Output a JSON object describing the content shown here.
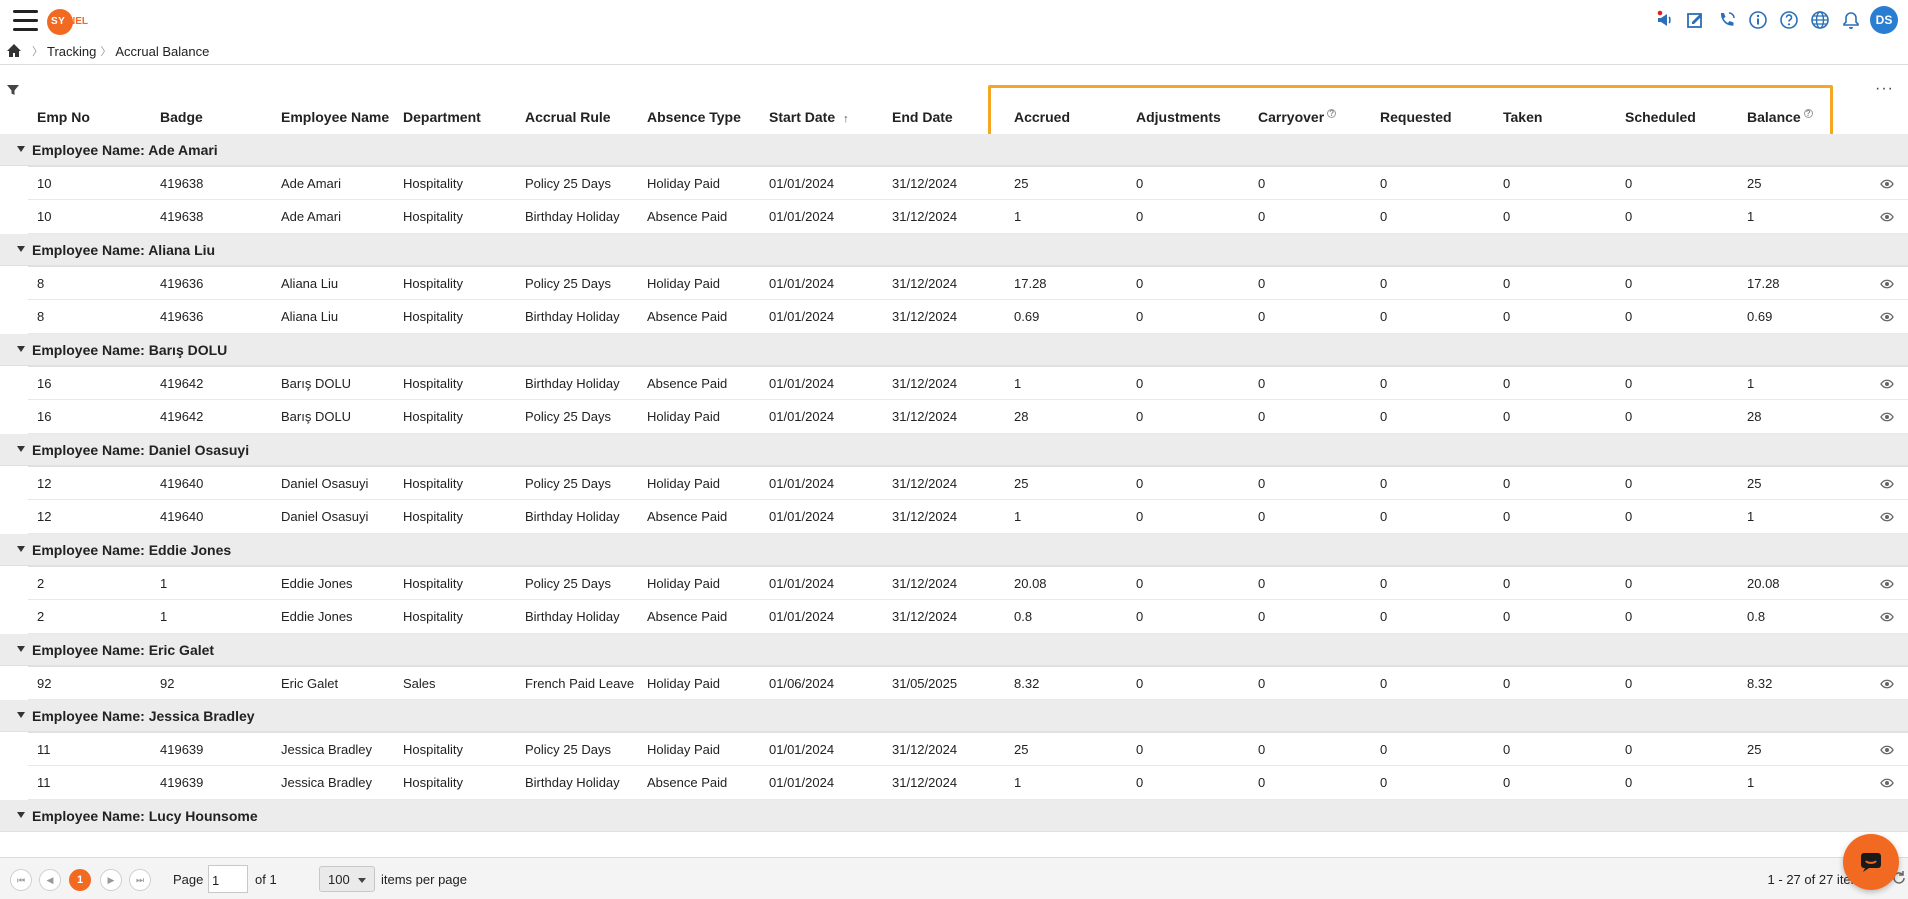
{
  "app": {
    "logo_text_a": "SY",
    "logo_text_b": "NEL",
    "user_initials": "DS"
  },
  "top_icons": [
    "announcement-icon",
    "timesheet-edit-icon",
    "phone-support-icon",
    "info-icon",
    "help-icon",
    "language-globe-icon",
    "notifications-bell-icon"
  ],
  "breadcrumb": {
    "items": [
      "Tracking",
      "Accrual Balance"
    ]
  },
  "grid": {
    "columns": [
      "Emp No",
      "Badge",
      "Employee Name",
      "Department",
      "Accrual Rule",
      "Absence Type",
      "Start Date",
      "End Date",
      "Accrued",
      "Adjustments",
      "Carryover",
      "Requested",
      "Taken",
      "Scheduled",
      "Balance"
    ],
    "help_marker": "?",
    "sort_indicator": "↑",
    "groups": [
      {
        "label": "Employee Name: Ade Amari",
        "rows": [
          [
            "10",
            "419638",
            "Ade Amari",
            "Hospitality",
            "Policy 25 Days",
            "Holiday Paid",
            "01/01/2024",
            "31/12/2024",
            "25",
            "0",
            "0",
            "0",
            "0",
            "0",
            "25"
          ],
          [
            "10",
            "419638",
            "Ade Amari",
            "Hospitality",
            "Birthday Holiday",
            "Absence Paid",
            "01/01/2024",
            "31/12/2024",
            "1",
            "0",
            "0",
            "0",
            "0",
            "0",
            "1"
          ]
        ]
      },
      {
        "label": "Employee Name: Aliana Liu",
        "rows": [
          [
            "8",
            "419636",
            "Aliana Liu",
            "Hospitality",
            "Policy 25 Days",
            "Holiday Paid",
            "01/01/2024",
            "31/12/2024",
            "17.28",
            "0",
            "0",
            "0",
            "0",
            "0",
            "17.28"
          ],
          [
            "8",
            "419636",
            "Aliana Liu",
            "Hospitality",
            "Birthday Holiday",
            "Absence Paid",
            "01/01/2024",
            "31/12/2024",
            "0.69",
            "0",
            "0",
            "0",
            "0",
            "0",
            "0.69"
          ]
        ]
      },
      {
        "label": "Employee Name: Barış DOLU",
        "rows": [
          [
            "16",
            "419642",
            "Barış DOLU",
            "Hospitality",
            "Birthday Holiday",
            "Absence Paid",
            "01/01/2024",
            "31/12/2024",
            "1",
            "0",
            "0",
            "0",
            "0",
            "0",
            "1"
          ],
          [
            "16",
            "419642",
            "Barış DOLU",
            "Hospitality",
            "Policy 25 Days",
            "Holiday Paid",
            "01/01/2024",
            "31/12/2024",
            "28",
            "0",
            "0",
            "0",
            "0",
            "0",
            "28"
          ]
        ]
      },
      {
        "label": "Employee Name: Daniel Osasuyi",
        "rows": [
          [
            "12",
            "419640",
            "Daniel Osasuyi",
            "Hospitality",
            "Policy 25 Days",
            "Holiday Paid",
            "01/01/2024",
            "31/12/2024",
            "25",
            "0",
            "0",
            "0",
            "0",
            "0",
            "25"
          ],
          [
            "12",
            "419640",
            "Daniel Osasuyi",
            "Hospitality",
            "Birthday Holiday",
            "Absence Paid",
            "01/01/2024",
            "31/12/2024",
            "1",
            "0",
            "0",
            "0",
            "0",
            "0",
            "1"
          ]
        ]
      },
      {
        "label": "Employee Name: Eddie Jones",
        "rows": [
          [
            "2",
            "1",
            "Eddie Jones",
            "Hospitality",
            "Policy 25 Days",
            "Holiday Paid",
            "01/01/2024",
            "31/12/2024",
            "20.08",
            "0",
            "0",
            "0",
            "0",
            "0",
            "20.08"
          ],
          [
            "2",
            "1",
            "Eddie Jones",
            "Hospitality",
            "Birthday Holiday",
            "Absence Paid",
            "01/01/2024",
            "31/12/2024",
            "0.8",
            "0",
            "0",
            "0",
            "0",
            "0",
            "0.8"
          ]
        ]
      },
      {
        "label": "Employee Name: Eric Galet",
        "rows": [
          [
            "92",
            "92",
            "Eric Galet",
            "Sales",
            "French Paid Leave",
            "Holiday Paid",
            "01/06/2024",
            "31/05/2025",
            "8.32",
            "0",
            "0",
            "0",
            "0",
            "0",
            "8.32"
          ]
        ]
      },
      {
        "label": "Employee Name: Jessica Bradley",
        "rows": [
          [
            "11",
            "419639",
            "Jessica Bradley",
            "Hospitality",
            "Policy 25 Days",
            "Holiday Paid",
            "01/01/2024",
            "31/12/2024",
            "25",
            "0",
            "0",
            "0",
            "0",
            "0",
            "25"
          ],
          [
            "11",
            "419639",
            "Jessica Bradley",
            "Hospitality",
            "Birthday Holiday",
            "Absence Paid",
            "01/01/2024",
            "31/12/2024",
            "1",
            "0",
            "0",
            "0",
            "0",
            "0",
            "1"
          ]
        ]
      },
      {
        "label": "Employee Name: Lucy Hounsome",
        "rows": []
      }
    ]
  },
  "pager": {
    "current_page": "1",
    "page_label": "Page",
    "page_value": "1",
    "of_label": "of 1",
    "per_page_value": "100",
    "per_page_label": "items per page",
    "range_text": "1 - 27 of 27 items"
  },
  "colors": {
    "accent": "#f26a21",
    "highlight": "#f5a623",
    "avatar": "#2a7ed2",
    "icon_blue": "#2a6fb8"
  }
}
